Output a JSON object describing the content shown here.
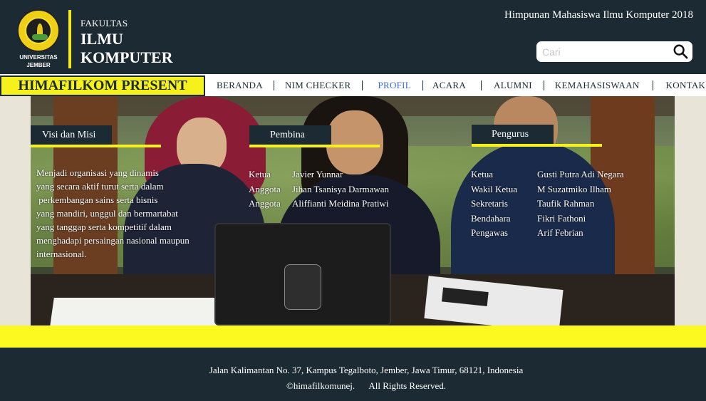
{
  "header": {
    "logo_caption_line1": "UNIVERSITAS",
    "logo_caption_line2": "JEMBER",
    "faculty_small": "FAKULTAS",
    "faculty_line1": "ILMU",
    "faculty_line2": "KOMPUTER",
    "org_name": "Himpunan Mahasiswa Ilmu Komputer 2018",
    "search_placeholder": "Cari"
  },
  "nav": {
    "present": "HIMAFILKOM PRESENT",
    "items": [
      {
        "label": "BERANDA"
      },
      {
        "label": "NIM CHECKER"
      },
      {
        "label": "PROFIL",
        "active": true
      },
      {
        "label": "ACARA"
      },
      {
        "label": "ALUMNI"
      },
      {
        "label": "KEMAHASISWAAN"
      },
      {
        "label": "KONTAK"
      }
    ]
  },
  "hero": {
    "visi": {
      "title": "Visi dan Misi",
      "lines": [
        "Menjadi organisasi yang dinamis",
        "yang secara aktif turut serta dalam",
        " perkembangan sains serta bisnis",
        "yang mandiri, unggul dan bermartabat",
        "yang tanggap serta kompetitif dalam",
        "menghadapi persaingan nasional maupun",
        "internasional."
      ]
    },
    "pembina": {
      "title": "Pembina",
      "rows": [
        {
          "role": "Ketua",
          "name": "Javier Yunnar"
        },
        {
          "role": "Anggota",
          "name": "Jihan Tsanisya Darmawan"
        },
        {
          "role": "Anggota",
          "name": "Aliffianti Meidina Pratiwi"
        }
      ]
    },
    "pengurus": {
      "title": "Pengurus",
      "rows": [
        {
          "role": "Ketua",
          "name": "Gusti Putra Adi Negara"
        },
        {
          "role": "Wakil Ketua",
          "name": "M Suzatmiko Ilham"
        },
        {
          "role": "Sekretaris",
          "name": "Taufik Rahman"
        },
        {
          "role": "Bendahara",
          "name": "Fikri Fathoni"
        },
        {
          "role": "Pengawas",
          "name": "Arif Febrian"
        }
      ]
    }
  },
  "footer": {
    "address": "Jalan Kalimantan No. 37, Kampus Tegalboto, Jember, Jawa Timur, 68121, Indonesia",
    "handle": "©himafilkomunej.",
    "rights": "All Rights Reserved."
  },
  "colors": {
    "dark": "#1b2a33",
    "accent_yellow": "#f6f01c",
    "active_link": "#3a6ad6"
  }
}
